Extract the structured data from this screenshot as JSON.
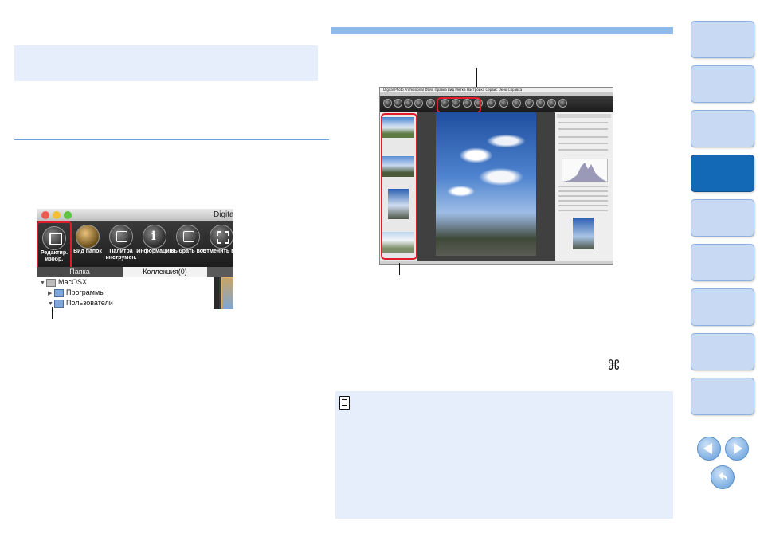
{
  "colors": {
    "accent": "#1469b7",
    "tab_inactive": "#c8daf3",
    "highlight": "#e01e2b",
    "panel_bg": "#e6eefb",
    "bar": "#8ebbea"
  },
  "mac_window": {
    "title": "Digita",
    "toolbar": [
      {
        "label": "Редактир. изобр.",
        "icon": "edit-image-icon"
      },
      {
        "label": "Вид папок",
        "icon": "folder-view-icon"
      },
      {
        "label": "Палитра инструмен.",
        "icon": "tool-palette-icon"
      },
      {
        "label": "Информация",
        "icon": "info-icon"
      },
      {
        "label": "Выбрать все",
        "icon": "select-all-icon"
      },
      {
        "label": "Отменить все",
        "icon": "deselect-all-icon"
      }
    ],
    "tabs": [
      "Папка",
      "Коллекция(0)"
    ],
    "tree": [
      "MacOSX",
      "Программы",
      "Пользователи"
    ]
  },
  "dpp": {
    "menu": "Digital Photo Professional  Файл  Правка  Вид  Метка  Настройка  Сервис  Окно  Справка"
  },
  "cmd_symbol": "⌘"
}
